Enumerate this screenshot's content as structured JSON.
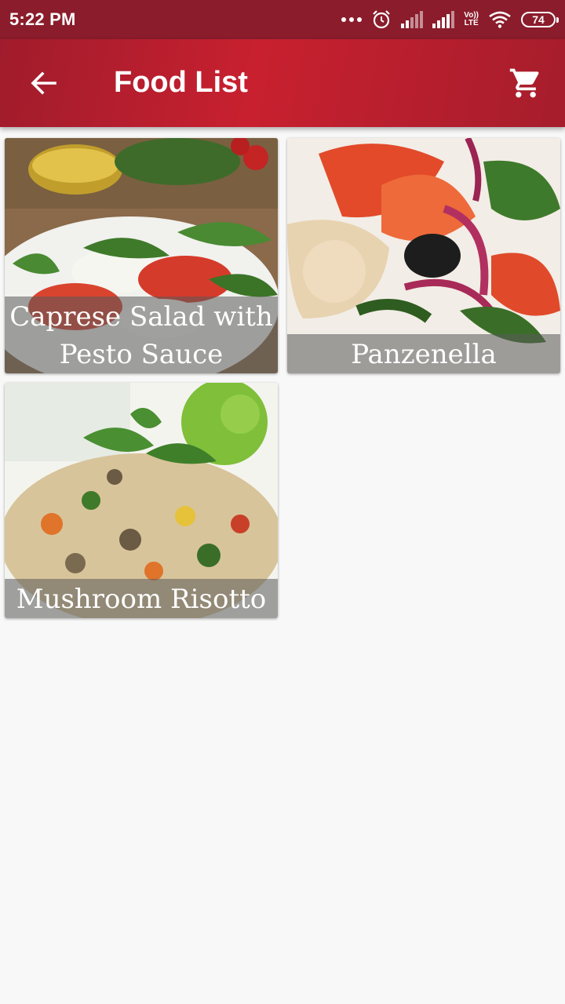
{
  "status_bar": {
    "time": "5:22 PM",
    "volte_top": "Vo))",
    "volte_bottom": "LTE",
    "battery": "74",
    "icons": [
      "more-dots-icon",
      "alarm-icon",
      "signal-icon",
      "signal-icon",
      "volte-icon",
      "wifi-icon",
      "battery-icon"
    ]
  },
  "toolbar": {
    "title": "Food List",
    "back_icon": "arrow-back-icon",
    "cart_icon": "shopping-cart-icon"
  },
  "foods": [
    {
      "name": "Caprese Salad with Pesto Sauce",
      "line1": "Caprese Salad with",
      "line2": "Pesto Sauce"
    },
    {
      "name": "Panzenella"
    },
    {
      "name": "Mushroom Risotto"
    }
  ],
  "colors": {
    "status_bar": "#8a1c2b",
    "toolbar": "#c8202f",
    "background": "#f8f8f8"
  }
}
